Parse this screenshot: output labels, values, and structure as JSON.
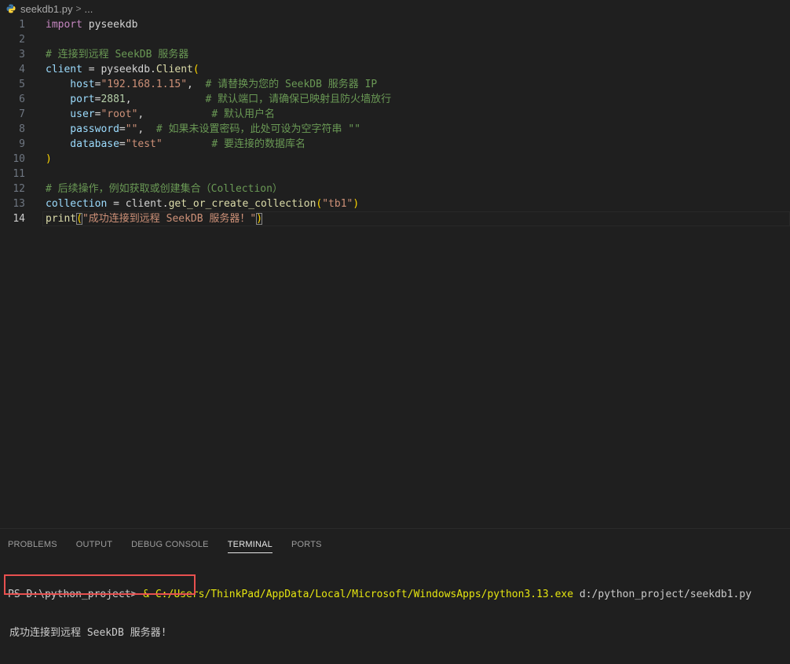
{
  "breadcrumb": {
    "file": "seekdb1.py",
    "sep": ">",
    "more": "..."
  },
  "editor": {
    "current_line": 14,
    "lines": [
      {
        "n": "1",
        "tokens": [
          {
            "t": "import",
            "c": "kw"
          },
          {
            "t": " pyseekdb",
            "c": "id"
          }
        ]
      },
      {
        "n": "2",
        "tokens": []
      },
      {
        "n": "3",
        "tokens": [
          {
            "t": "# 连接到远程 SeekDB 服务器",
            "c": "cm"
          }
        ]
      },
      {
        "n": "4",
        "tokens": [
          {
            "t": "client",
            "c": "var"
          },
          {
            "t": " = pyseekdb.",
            "c": "id"
          },
          {
            "t": "Client",
            "c": "fn"
          },
          {
            "t": "(",
            "c": "br1"
          }
        ]
      },
      {
        "n": "5",
        "tokens": [
          {
            "t": "    host",
            "c": "var"
          },
          {
            "t": "=",
            "c": "id"
          },
          {
            "t": "\"192.168.1.15\"",
            "c": "str"
          },
          {
            "t": ",  ",
            "c": "id"
          },
          {
            "t": "# 请替换为您的 SeekDB 服务器 IP",
            "c": "cm"
          }
        ]
      },
      {
        "n": "6",
        "tokens": [
          {
            "t": "    port",
            "c": "var"
          },
          {
            "t": "=",
            "c": "id"
          },
          {
            "t": "2881",
            "c": "num"
          },
          {
            "t": ",            ",
            "c": "id"
          },
          {
            "t": "# 默认端口，请确保已映射且防火墙放行",
            "c": "cm"
          }
        ]
      },
      {
        "n": "7",
        "tokens": [
          {
            "t": "    user",
            "c": "var"
          },
          {
            "t": "=",
            "c": "id"
          },
          {
            "t": "\"root\"",
            "c": "str"
          },
          {
            "t": ",           ",
            "c": "id"
          },
          {
            "t": "# 默认用户名",
            "c": "cm"
          }
        ]
      },
      {
        "n": "8",
        "tokens": [
          {
            "t": "    password",
            "c": "var"
          },
          {
            "t": "=",
            "c": "id"
          },
          {
            "t": "\"\"",
            "c": "str"
          },
          {
            "t": ",  ",
            "c": "id"
          },
          {
            "t": "# 如果未设置密码，此处可设为空字符串 \"\"",
            "c": "cm"
          }
        ]
      },
      {
        "n": "9",
        "tokens": [
          {
            "t": "    database",
            "c": "var"
          },
          {
            "t": "=",
            "c": "id"
          },
          {
            "t": "\"test\"",
            "c": "str"
          },
          {
            "t": "        ",
            "c": "id"
          },
          {
            "t": "# 要连接的数据库名",
            "c": "cm"
          }
        ]
      },
      {
        "n": "10",
        "tokens": [
          {
            "t": ")",
            "c": "br1"
          }
        ]
      },
      {
        "n": "11",
        "tokens": []
      },
      {
        "n": "12",
        "tokens": [
          {
            "t": "# 后续操作，例如获取或创建集合（Collection）",
            "c": "cm"
          }
        ]
      },
      {
        "n": "13",
        "tokens": [
          {
            "t": "collection",
            "c": "var"
          },
          {
            "t": " = client.",
            "c": "id"
          },
          {
            "t": "get_or_create_collection",
            "c": "fn"
          },
          {
            "t": "(",
            "c": "br1"
          },
          {
            "t": "\"tb1\"",
            "c": "str"
          },
          {
            "t": ")",
            "c": "br1"
          }
        ]
      },
      {
        "n": "14",
        "tokens": [
          {
            "t": "print",
            "c": "fn"
          },
          {
            "t": "(",
            "c": "br1 brm"
          },
          {
            "t": "\"成功连接到远程 SeekDB 服务器！\"",
            "c": "str"
          },
          {
            "t": ")",
            "c": "br1 brm"
          }
        ]
      }
    ]
  },
  "panel": {
    "tabs": [
      {
        "label": "PROBLEMS",
        "active": false
      },
      {
        "label": "OUTPUT",
        "active": false
      },
      {
        "label": "DEBUG CONSOLE",
        "active": false
      },
      {
        "label": "TERMINAL",
        "active": true
      },
      {
        "label": "PORTS",
        "active": false
      }
    ],
    "terminal": {
      "prompt": "PS D:\\python_project> ",
      "amp": "& ",
      "exe": "C:/Users/ThinkPad/AppData/Local/Microsoft/WindowsApps/python3.13.exe",
      "arg": " d:/python_project/seekdb1.py",
      "output": "成功连接到远程 SeekDB 服务器!"
    }
  },
  "colors": {
    "background": "#1f1f1f",
    "highlight_box": "#e8504f"
  }
}
